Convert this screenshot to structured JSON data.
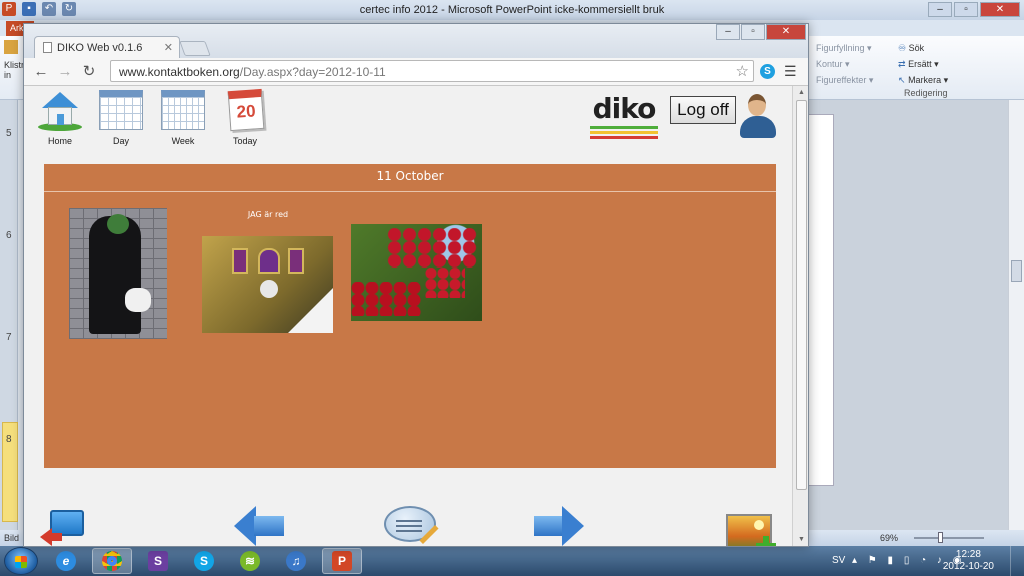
{
  "powerpoint": {
    "window_title": "certec info 2012  -  Microsoft PowerPoint icke-kommersiellt bruk",
    "file_tab": "Arkiv",
    "clipboard_label_1": "Klistra",
    "clipboard_label_2": "in",
    "ribbon": {
      "shape_fill": "Figurfyllning",
      "shape_outline": "Kontur",
      "shape_effects": "Figureffekter",
      "find": "Sök",
      "replace": "Ersätt",
      "select": "Markera",
      "editing_group": "Redigering"
    },
    "slide_numbers": [
      "5",
      "6",
      "7",
      "8"
    ],
    "status_left": "Bild",
    "zoom": "69%"
  },
  "taskbar": {
    "language": "SV",
    "time": "12:28",
    "date": "2012-10-20",
    "apps": [
      "internet-explorer",
      "chrome",
      "sharepoint",
      "skype",
      "spotify",
      "itunes",
      "powerpoint"
    ]
  },
  "browser": {
    "tab_title": "DIKO Web v0.1.6",
    "url_host": "www.kontaktboken.org",
    "url_path": "/Day.aspx?day=2012-10-11"
  },
  "app": {
    "nav": {
      "home": "Home",
      "day": "Day",
      "week": "Week",
      "today": "Today",
      "today_number": "20"
    },
    "logo_text": "diko",
    "logo_colors": [
      "#4fae3b",
      "#f2c230",
      "#d53c32",
      "#3a7cc4"
    ],
    "logoff_label": "Log off",
    "day_header": "11 October",
    "panel_color": "#c87847",
    "photo_caption": "JAG är red"
  }
}
